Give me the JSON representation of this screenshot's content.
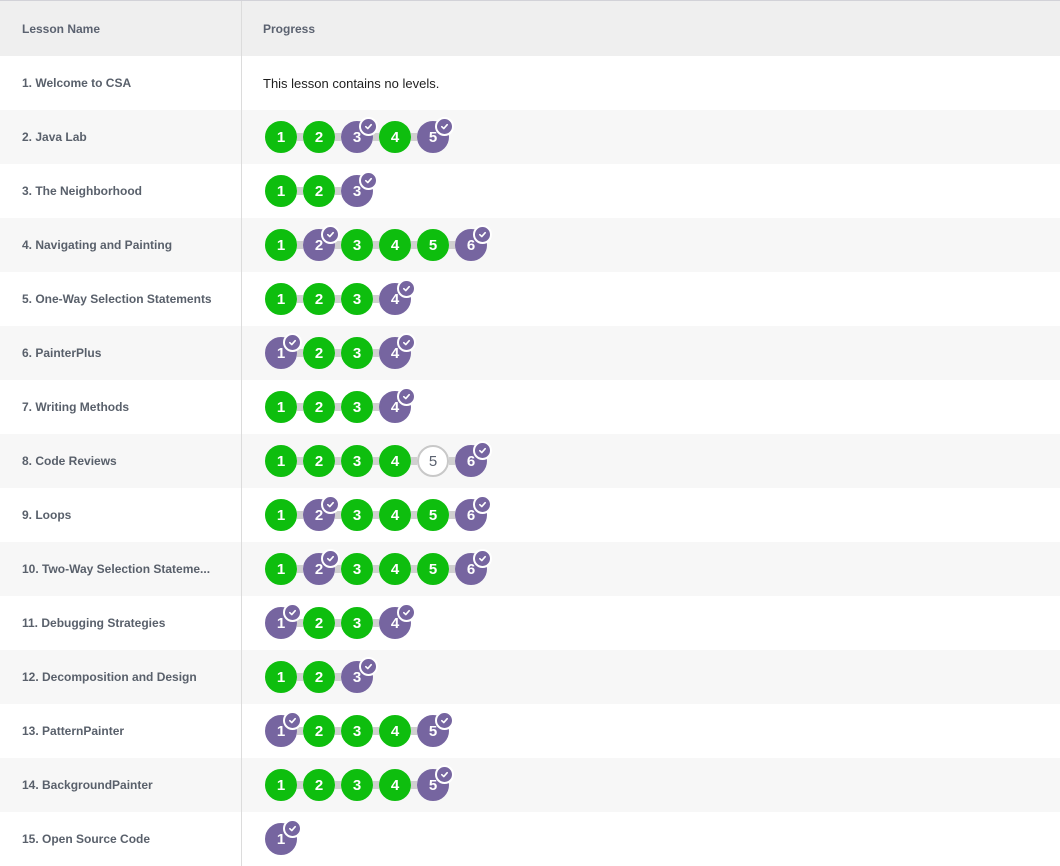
{
  "header": {
    "lesson_name": "Lesson Name",
    "progress": "Progress"
  },
  "lessons": [
    {
      "name": "1. Welcome to CSA",
      "message": "This lesson contains no levels.",
      "levels": []
    },
    {
      "name": "2. Java Lab",
      "levels": [
        {
          "label": "1",
          "status": "perfect"
        },
        {
          "label": "2",
          "status": "perfect"
        },
        {
          "label": "3",
          "status": "assessed"
        },
        {
          "label": "4",
          "status": "perfect"
        },
        {
          "label": "5",
          "status": "assessed"
        }
      ]
    },
    {
      "name": "3. The Neighborhood",
      "levels": [
        {
          "label": "1",
          "status": "perfect"
        },
        {
          "label": "2",
          "status": "perfect"
        },
        {
          "label": "3",
          "status": "assessed"
        }
      ]
    },
    {
      "name": "4. Navigating and Painting",
      "levels": [
        {
          "label": "1",
          "status": "perfect"
        },
        {
          "label": "2",
          "status": "assessed"
        },
        {
          "label": "3",
          "status": "perfect"
        },
        {
          "label": "4",
          "status": "perfect"
        },
        {
          "label": "5",
          "status": "perfect"
        },
        {
          "label": "6",
          "status": "assessed"
        }
      ]
    },
    {
      "name": "5. One-Way Selection Statements",
      "levels": [
        {
          "label": "1",
          "status": "perfect"
        },
        {
          "label": "2",
          "status": "perfect"
        },
        {
          "label": "3",
          "status": "perfect"
        },
        {
          "label": "4",
          "status": "assessed"
        }
      ]
    },
    {
      "name": "6. PainterPlus",
      "levels": [
        {
          "label": "1",
          "status": "assessed"
        },
        {
          "label": "2",
          "status": "perfect"
        },
        {
          "label": "3",
          "status": "perfect"
        },
        {
          "label": "4",
          "status": "assessed"
        }
      ]
    },
    {
      "name": "7. Writing Methods",
      "levels": [
        {
          "label": "1",
          "status": "perfect"
        },
        {
          "label": "2",
          "status": "perfect"
        },
        {
          "label": "3",
          "status": "perfect"
        },
        {
          "label": "4",
          "status": "assessed"
        }
      ]
    },
    {
      "name": "8. Code Reviews",
      "levels": [
        {
          "label": "1",
          "status": "perfect"
        },
        {
          "label": "2",
          "status": "perfect"
        },
        {
          "label": "3",
          "status": "perfect"
        },
        {
          "label": "4",
          "status": "perfect"
        },
        {
          "label": "5",
          "status": "empty"
        },
        {
          "label": "6",
          "status": "assessed"
        }
      ]
    },
    {
      "name": "9. Loops",
      "levels": [
        {
          "label": "1",
          "status": "perfect"
        },
        {
          "label": "2",
          "status": "assessed"
        },
        {
          "label": "3",
          "status": "perfect"
        },
        {
          "label": "4",
          "status": "perfect"
        },
        {
          "label": "5",
          "status": "perfect"
        },
        {
          "label": "6",
          "status": "assessed"
        }
      ]
    },
    {
      "name": "10. Two-Way Selection Stateme...",
      "levels": [
        {
          "label": "1",
          "status": "perfect"
        },
        {
          "label": "2",
          "status": "assessed"
        },
        {
          "label": "3",
          "status": "perfect"
        },
        {
          "label": "4",
          "status": "perfect"
        },
        {
          "label": "5",
          "status": "perfect"
        },
        {
          "label": "6",
          "status": "assessed"
        }
      ]
    },
    {
      "name": "11. Debugging Strategies",
      "levels": [
        {
          "label": "1",
          "status": "assessed"
        },
        {
          "label": "2",
          "status": "perfect"
        },
        {
          "label": "3",
          "status": "perfect"
        },
        {
          "label": "4",
          "status": "assessed"
        }
      ]
    },
    {
      "name": "12. Decomposition and Design",
      "levels": [
        {
          "label": "1",
          "status": "perfect"
        },
        {
          "label": "2",
          "status": "perfect"
        },
        {
          "label": "3",
          "status": "assessed"
        }
      ]
    },
    {
      "name": "13. PatternPainter",
      "levels": [
        {
          "label": "1",
          "status": "assessed"
        },
        {
          "label": "2",
          "status": "perfect"
        },
        {
          "label": "3",
          "status": "perfect"
        },
        {
          "label": "4",
          "status": "perfect"
        },
        {
          "label": "5",
          "status": "assessed"
        }
      ]
    },
    {
      "name": "14. BackgroundPainter",
      "levels": [
        {
          "label": "1",
          "status": "perfect"
        },
        {
          "label": "2",
          "status": "perfect"
        },
        {
          "label": "3",
          "status": "perfect"
        },
        {
          "label": "4",
          "status": "perfect"
        },
        {
          "label": "5",
          "status": "assessed"
        }
      ]
    },
    {
      "name": "15. Open Source Code",
      "levels": [
        {
          "label": "1",
          "status": "assessed"
        }
      ]
    }
  ],
  "colors": {
    "perfect": "#0ebe0e",
    "assessed": "#7665a0",
    "empty_border": "#c8c8c8",
    "connector": "#d0d0d0"
  }
}
